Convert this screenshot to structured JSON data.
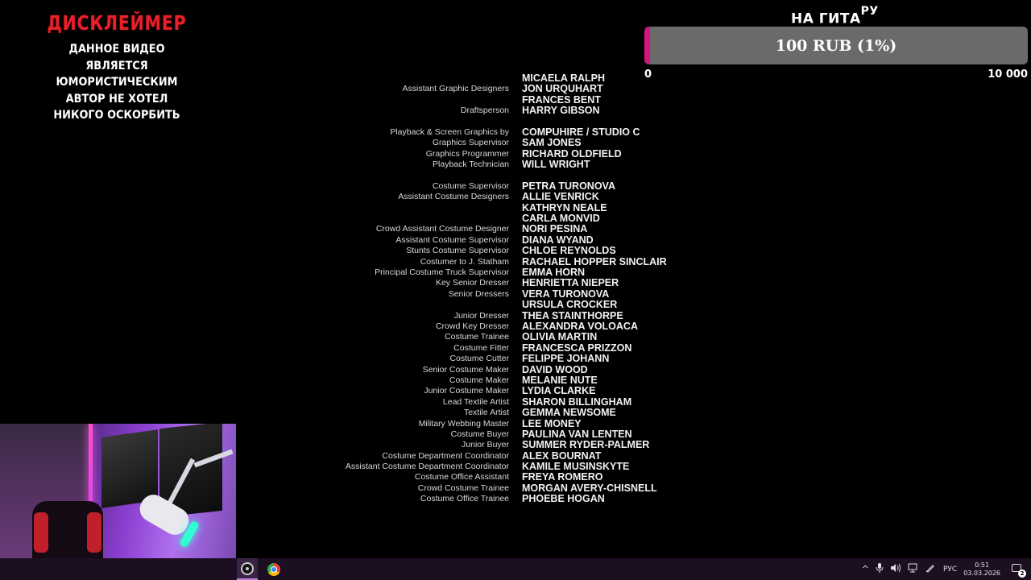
{
  "disclaimer": {
    "title": "ДИСКЛЕЙМЕР",
    "lines": [
      "ДАННОЕ ВИДЕО",
      "ЯВЛЯЕТСЯ ЮМОРИСТИЧЕСКИМ",
      "АВТОР НЕ ХОТЕЛ",
      "НИКОГО ОСКОРБИТЬ"
    ]
  },
  "goal": {
    "title": "НА ГИТА",
    "title_sup": "РУ",
    "progress_text": "100 RUB (1%)",
    "progress_fraction": 0.01,
    "min_label": "0",
    "max_label": "10 000",
    "fill_color": "#d4147f"
  },
  "credits": [
    {
      "role": "",
      "name": "MICAELA RALPH"
    },
    {
      "role": "Assistant Graphic Designers",
      "name": "JON URQUHART"
    },
    {
      "role": "",
      "name": "FRANCES BENT"
    },
    {
      "role": "Draftsperson",
      "name": "HARRY GIBSON"
    },
    {
      "gap": true
    },
    {
      "role": "Playback & Screen Graphics by",
      "name": "COMPUHIRE / STUDIO C"
    },
    {
      "role": "Graphics Supervisor",
      "name": "SAM JONES"
    },
    {
      "role": "Graphics Programmer",
      "name": "RICHARD OLDFIELD"
    },
    {
      "role": "Playback Technician",
      "name": "WILL WRIGHT"
    },
    {
      "gap": true
    },
    {
      "role": "Costume Supervisor",
      "name": "PETRA TURONOVA"
    },
    {
      "role": "Assistant Costume Designers",
      "name": "ALLIE VENRICK"
    },
    {
      "role": "",
      "name": "KATHRYN NEALE"
    },
    {
      "role": "",
      "name": "CARLA MONVID"
    },
    {
      "role": "Crowd Assistant Costume Designer",
      "name": "NORI PESINA"
    },
    {
      "role": "Assistant Costume Supervisor",
      "name": "DIANA WYAND"
    },
    {
      "role": "Stunts Costume Supervisor",
      "name": "CHLOE REYNOLDS"
    },
    {
      "role": "Costumer to J. Statham",
      "name": "RACHAEL HOPPER SINCLAIR"
    },
    {
      "role": "Principal Costume Truck Supervisor",
      "name": "EMMA HORN"
    },
    {
      "role": "Key Senior Dresser",
      "name": "HENRIETTA NIEPER"
    },
    {
      "role": "Senior Dressers",
      "name": "VERA TURONOVA"
    },
    {
      "role": "",
      "name": "URSULA CROCKER"
    },
    {
      "role": "Junior Dresser",
      "name": "THEA STAINTHORPE"
    },
    {
      "role": "Crowd Key Dresser",
      "name": "ALEXANDRA VOLOACA"
    },
    {
      "role": "Costume Trainee",
      "name": "OLIVIA MARTIN"
    },
    {
      "role": "Costume Fitter",
      "name": "FRANCESCA PRIZZON"
    },
    {
      "role": "Costume Cutter",
      "name": "FELIPPE JOHANN"
    },
    {
      "role": "Senior Costume Maker",
      "name": "DAVID WOOD"
    },
    {
      "role": "Costume Maker",
      "name": "MELANIE NUTE"
    },
    {
      "role": "Junior Costume Maker",
      "name": "LYDIA CLARKE"
    },
    {
      "role": "Lead Textile Artist",
      "name": "SHARON BILLINGHAM"
    },
    {
      "role": "Textile Artist",
      "name": "GEMMA NEWSOME"
    },
    {
      "role": "Military Webbing Master",
      "name": "LEE MONEY"
    },
    {
      "role": "Costume Buyer",
      "name": "PAULINA VAN LENTEN"
    },
    {
      "role": "Junior Buyer",
      "name": "SUMMER RYDER-PALMER"
    },
    {
      "role": "Costume Department Coordinator",
      "name": "ALEX BOURNAT"
    },
    {
      "role": "Assistant Costume Department Coordinator",
      "name": "KAMILE MUSINSKYTE"
    },
    {
      "role": "Costume Office Assistant",
      "name": "FREYA ROMERO"
    },
    {
      "role": "Crowd Costume Trainee",
      "name": "MORGAN AVERY-CHISNELL"
    },
    {
      "role": "Costume Office Trainee",
      "name": "PHOEBE HOGAN"
    }
  ],
  "taskbar": {
    "apps": [
      {
        "icon": "obs-icon",
        "active": true
      },
      {
        "icon": "chrome-icon",
        "active": false
      }
    ],
    "tray": {
      "chevron": "^",
      "language": "РУС",
      "time": "0:51",
      "date": "03.03.2026",
      "notification_count": "2"
    }
  }
}
